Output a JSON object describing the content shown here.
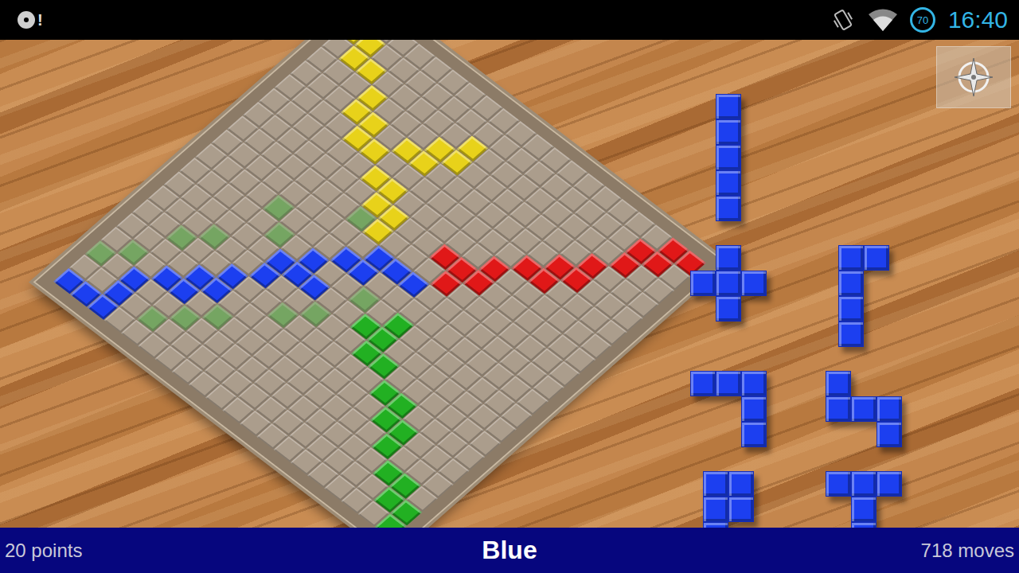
{
  "status_bar": {
    "notification_badge": "!",
    "battery": "70",
    "time": "16:40"
  },
  "board": {
    "size": 20,
    "pieces": [
      {
        "color": "#e8d21a",
        "cells": [
          [
            0,
            0
          ],
          [
            1,
            0
          ],
          [
            1,
            1
          ],
          [
            2,
            1
          ],
          [
            2,
            2
          ]
        ]
      },
      {
        "color": "#e8d21a",
        "cells": [
          [
            3,
            3
          ],
          [
            4,
            3
          ],
          [
            4,
            4
          ],
          [
            5,
            4
          ],
          [
            5,
            5
          ]
        ]
      },
      {
        "color": "#e8d21a",
        "cells": [
          [
            6,
            6
          ],
          [
            6,
            7
          ],
          [
            7,
            7
          ],
          [
            7,
            8
          ],
          [
            8,
            8
          ]
        ]
      },
      {
        "color": "#e8d21a",
        "cells": [
          [
            4,
            6
          ],
          [
            4,
            7
          ],
          [
            3,
            7
          ],
          [
            3,
            8
          ],
          [
            2,
            8
          ]
        ]
      },
      {
        "color": "#e01818",
        "cells": [
          [
            0,
            19
          ],
          [
            0,
            18
          ],
          [
            1,
            18
          ],
          [
            1,
            17
          ],
          [
            2,
            17
          ]
        ]
      },
      {
        "color": "#e01818",
        "cells": [
          [
            3,
            16
          ],
          [
            4,
            16
          ],
          [
            4,
            15
          ],
          [
            5,
            15
          ],
          [
            5,
            14
          ]
        ]
      },
      {
        "color": "#e01818",
        "cells": [
          [
            6,
            13
          ],
          [
            7,
            13
          ],
          [
            7,
            12
          ],
          [
            8,
            12
          ],
          [
            7,
            11
          ]
        ]
      },
      {
        "color": "#1c3ff0",
        "cells": [
          [
            19,
            0
          ],
          [
            19,
            1
          ],
          [
            19,
            2
          ],
          [
            18,
            2
          ],
          [
            17,
            2
          ]
        ]
      },
      {
        "color": "#1c3ff0",
        "cells": [
          [
            16,
            3
          ],
          [
            16,
            4
          ],
          [
            15,
            4
          ],
          [
            15,
            5
          ],
          [
            14,
            5
          ]
        ]
      },
      {
        "color": "#1c3ff0",
        "cells": [
          [
            13,
            6
          ],
          [
            12,
            6
          ],
          [
            12,
            7
          ],
          [
            11,
            7
          ],
          [
            12,
            8
          ]
        ]
      },
      {
        "color": "#1c3ff0",
        "cells": [
          [
            10,
            8
          ],
          [
            10,
            9
          ],
          [
            9,
            9
          ],
          [
            9,
            10
          ],
          [
            9,
            11
          ]
        ]
      },
      {
        "color": "#22b022",
        "cells": [
          [
            19,
            19
          ],
          [
            18,
            19
          ],
          [
            18,
            18
          ],
          [
            17,
            18
          ],
          [
            17,
            17
          ]
        ]
      },
      {
        "color": "#22b022",
        "cells": [
          [
            16,
            16
          ],
          [
            15,
            16
          ],
          [
            15,
            15
          ],
          [
            14,
            15
          ],
          [
            14,
            14
          ]
        ]
      },
      {
        "color": "#22b022",
        "cells": [
          [
            13,
            13
          ],
          [
            13,
            12
          ],
          [
            12,
            12
          ],
          [
            12,
            11
          ],
          [
            11,
            12
          ]
        ]
      }
    ],
    "hints": {
      "color": "#5fcf5f",
      "cells": [
        [
          18,
          4
        ],
        [
          17,
          0
        ],
        [
          16,
          1
        ],
        [
          17,
          5
        ],
        [
          14,
          2
        ],
        [
          13,
          3
        ],
        [
          16,
          6
        ],
        [
          14,
          8
        ],
        [
          13,
          9
        ],
        [
          11,
          5
        ],
        [
          10,
          4
        ],
        [
          11,
          10
        ],
        [
          8,
          7
        ],
        [
          8,
          12
        ]
      ]
    }
  },
  "stock": {
    "color": "#1c3ff0",
    "rows": [
      [
        {
          "cells": [
            [
              0,
              0
            ],
            [
              1,
              0
            ],
            [
              2,
              0
            ],
            [
              3,
              0
            ],
            [
              4,
              0
            ]
          ]
        }
      ],
      [
        {
          "cells": [
            [
              0,
              1
            ],
            [
              1,
              0
            ],
            [
              1,
              1
            ],
            [
              1,
              2
            ],
            [
              2,
              1
            ]
          ]
        },
        {
          "cells": [
            [
              0,
              0
            ],
            [
              0,
              1
            ],
            [
              1,
              0
            ],
            [
              2,
              0
            ],
            [
              3,
              0
            ]
          ]
        }
      ],
      [
        {
          "cells": [
            [
              0,
              0
            ],
            [
              0,
              1
            ],
            [
              0,
              2
            ],
            [
              1,
              2
            ],
            [
              2,
              2
            ]
          ]
        },
        {
          "cells": [
            [
              0,
              0
            ],
            [
              1,
              0
            ],
            [
              1,
              1
            ],
            [
              1,
              2
            ],
            [
              2,
              2
            ]
          ]
        }
      ],
      [
        {
          "cells": [
            [
              0,
              0
            ],
            [
              0,
              1
            ],
            [
              1,
              0
            ],
            [
              1,
              1
            ],
            [
              2,
              0
            ]
          ]
        },
        {
          "cells": [
            [
              0,
              0
            ],
            [
              0,
              1
            ],
            [
              0,
              2
            ],
            [
              1,
              1
            ],
            [
              2,
              1
            ]
          ]
        }
      ]
    ]
  },
  "footer": {
    "points": "20 points",
    "player": "Blue",
    "moves": "718 moves"
  }
}
